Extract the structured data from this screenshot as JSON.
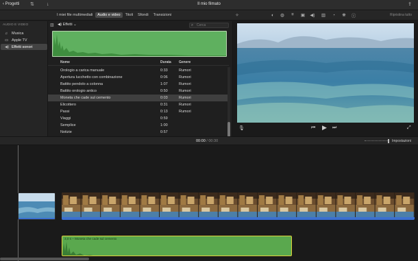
{
  "toolbar": {
    "back_label": "Progetti",
    "title": "Il mio filmato",
    "icons": [
      "media-import-icon",
      "download-icon",
      "share-icon"
    ]
  },
  "browser_tabs": [
    {
      "label": "I miei file multimediali",
      "active": false
    },
    {
      "label": "Audio e video",
      "active": true
    },
    {
      "label": "Titoli",
      "active": false
    },
    {
      "label": "Sfondi",
      "active": false
    },
    {
      "label": "Transizioni",
      "active": false
    }
  ],
  "viewer_tools": {
    "reset_all_label": "Ripristina tutto",
    "icons": [
      "color-balance-icon",
      "color-correction-icon",
      "crop-icon",
      "stabilization-icon",
      "volume-icon",
      "noise-reduction-icon",
      "speed-icon",
      "clip-filter-icon",
      "info-icon"
    ]
  },
  "sidebar": {
    "section_label": "AUDIO E VIDEO",
    "items": [
      {
        "label": "Musica",
        "icon": "music-icon",
        "active": false
      },
      {
        "label": "Apple TV",
        "icon": "appletv-icon",
        "active": false
      },
      {
        "label": "Effetti sonori",
        "icon": "speaker-icon",
        "active": true
      }
    ]
  },
  "browser": {
    "title": "Effetti",
    "search_placeholder": "Cerca",
    "columns": [
      "Nome",
      "Durata",
      "Genere"
    ],
    "rows": [
      {
        "name": "Orologio a carica manuale",
        "duration": "0:33",
        "genre": "Rumori",
        "selected": false
      },
      {
        "name": "Apertura lucchetto con combinazione",
        "duration": "0:06",
        "genre": "Rumori",
        "selected": false
      },
      {
        "name": "Battito pendolo a colonna",
        "duration": "1:07",
        "genre": "Rumori",
        "selected": false
      },
      {
        "name": "Battito orologio antico",
        "duration": "0:50",
        "genre": "Rumori",
        "selected": false
      },
      {
        "name": "Moneta che cade sul cemento",
        "duration": "0:03",
        "genre": "Rumori",
        "selected": true
      },
      {
        "name": "Elicottero",
        "duration": "0:31",
        "genre": "Rumori",
        "selected": false
      },
      {
        "name": "Passi",
        "duration": "0:13",
        "genre": "Rumori",
        "selected": false
      },
      {
        "name": "Viaggi",
        "duration": "0:59",
        "genre": "",
        "selected": false
      },
      {
        "name": "Semplice",
        "duration": "1:00",
        "genre": "",
        "selected": false
      },
      {
        "name": "Notizie",
        "duration": "0:57",
        "genre": "",
        "selected": false
      }
    ]
  },
  "viewer_controls": [
    "microphone-icon",
    "skip-back-icon",
    "play-icon",
    "skip-forward-icon",
    "fullscreen-icon"
  ],
  "timeline": {
    "current_time": "00:00",
    "separator": "/",
    "total_time": "00:30",
    "settings_label": "Impostazioni",
    "audio_clip_label": "3,0 s – Moneta che cade sul cemento"
  },
  "colors": {
    "accent_green": "#5aa84e",
    "selection_yellow": "#e0d23a",
    "audio_blue": "#3b6fd0"
  }
}
